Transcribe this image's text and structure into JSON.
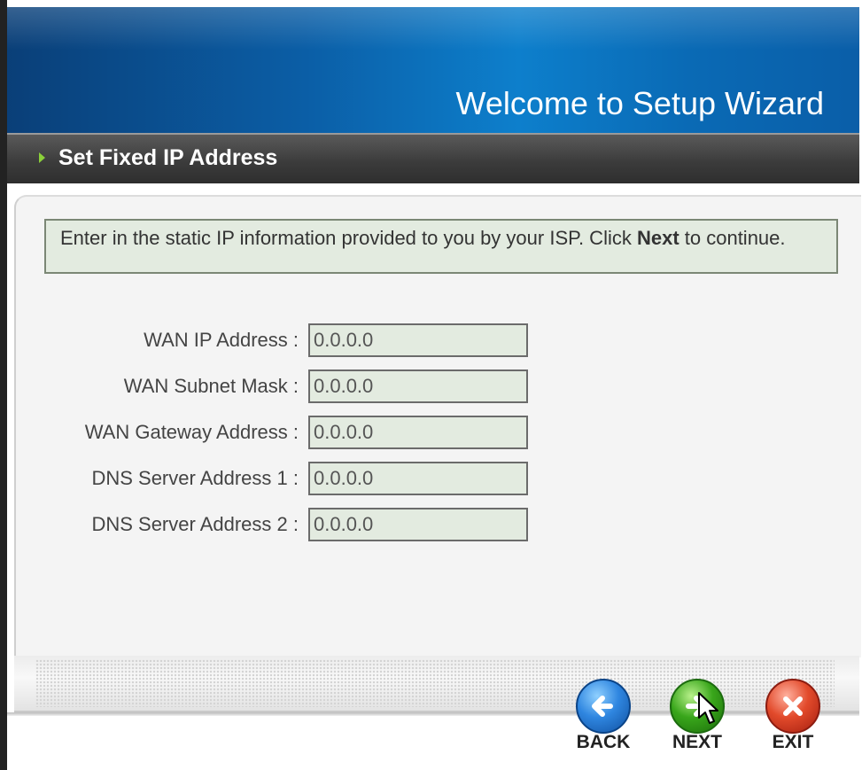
{
  "header": {
    "title": "Welcome to Setup Wizard"
  },
  "section": {
    "title": "Set Fixed IP Address"
  },
  "info": {
    "text_before": "Enter in the static IP information provided to you by your ISP. Click ",
    "bold": "Next",
    "text_after": " to continue."
  },
  "fields": [
    {
      "label": "WAN IP Address :",
      "value": "0.0.0.0"
    },
    {
      "label": "WAN Subnet Mask :",
      "value": "0.0.0.0"
    },
    {
      "label": "WAN Gateway Address :",
      "value": "0.0.0.0"
    },
    {
      "label": "DNS Server Address 1 :",
      "value": "0.0.0.0"
    },
    {
      "label": "DNS Server Address 2 :",
      "value": "0.0.0.0"
    }
  ],
  "buttons": {
    "back": "BACK",
    "next": "NEXT",
    "exit": "EXIT"
  },
  "colors": {
    "header_blue": "#0b5ea6",
    "section_bar": "#3c3c3c",
    "accent_green": "#8bd03a",
    "field_bg": "#e3ebe0"
  }
}
